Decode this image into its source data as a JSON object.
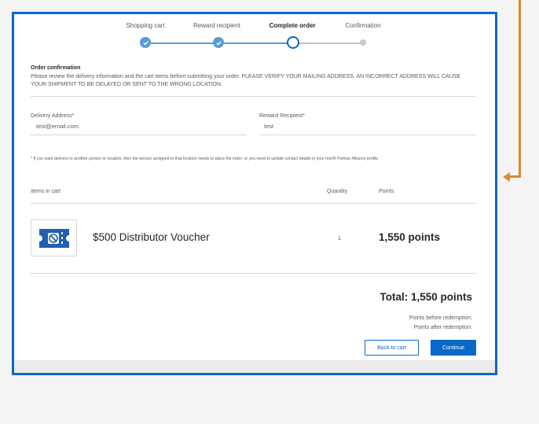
{
  "colors": {
    "accent": "#0b68c8",
    "step_done": "#5a9bd6",
    "annotation": "#e0892d"
  },
  "stepper": {
    "steps": [
      {
        "label": "Shopping cart",
        "state": "done"
      },
      {
        "label": "Reward recipient",
        "state": "done"
      },
      {
        "label": "Complete order",
        "state": "current"
      },
      {
        "label": "Confirmation",
        "state": "upcoming"
      }
    ]
  },
  "confirmation": {
    "title": "Order confirmation",
    "text": "Please review the delivery information and the cart items before submitting your order. PLEASE VERIFY YOUR MAILING ADDRESS. AN INCORRECT ADDRESS WILL CAUSE YOUR SHIPMENT TO BE DELAYED OR SENT TO THE WRONG LOCATION."
  },
  "delivery": {
    "label": "Delivery Address*",
    "value": "test@email.com"
  },
  "recipient": {
    "label": "Reward Recipient*",
    "value": "test"
  },
  "note": "* If you want delivery to another person or location, then the person assigned to that location needs to place the order, or you need to update contact details in your Intel® Partner Alliance profile.",
  "cart": {
    "headers": {
      "items": "Items in cart",
      "quantity": "Quantity",
      "points": "Points"
    },
    "items": [
      {
        "name": "$500 Distributor Voucher",
        "quantity": "1",
        "points": "1,550 points",
        "icon": "voucher-icon"
      }
    ]
  },
  "summary": {
    "total": "Total: 1,550 points",
    "before": "Points before redemption:",
    "after": "Points after redemption:"
  },
  "buttons": {
    "back": "Back to cart",
    "continue": "Continue"
  }
}
